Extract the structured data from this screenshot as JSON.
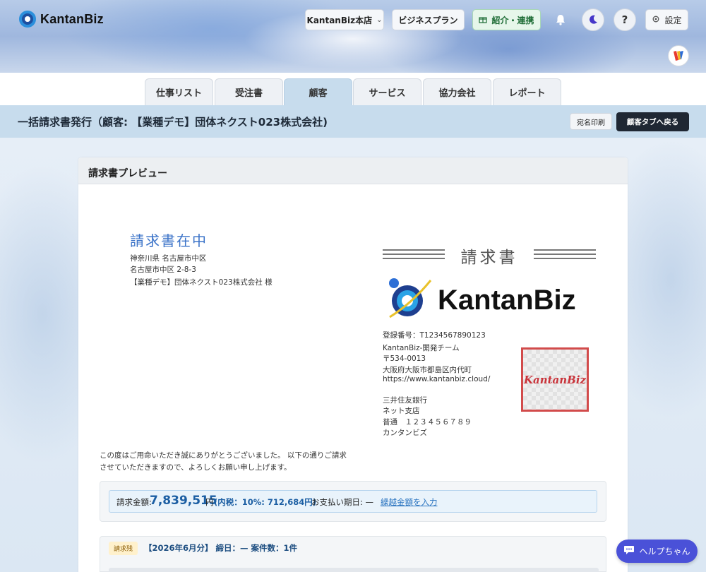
{
  "header": {
    "logo_text": "KantanBiz",
    "store_selector": "KantanBiz本店",
    "plan_button": "ビジネスプラン",
    "intro_button": "紹介・連携",
    "help_icon_label": "?",
    "settings_button": "設定"
  },
  "tabs": [
    {
      "label": "仕事リスト",
      "active": false
    },
    {
      "label": "受注書",
      "active": false
    },
    {
      "label": "顧客",
      "active": true
    },
    {
      "label": "サービス",
      "active": false
    },
    {
      "label": "協力会社",
      "active": false
    },
    {
      "label": "レポート",
      "active": false
    }
  ],
  "titlebar": {
    "title": "一括請求書発行（顧客: 【業種デモ】団体ネクスト023株式会社)",
    "print_button": "宛名印刷",
    "back_button": "顧客タブへ戻る"
  },
  "preview": {
    "section_title": "請求書プレビュー",
    "recipient": {
      "doc_title": "請求書在中",
      "address_line1": "神奈川県 名古屋市中区",
      "address_line2": "名古屋市中区 2-8-3",
      "name": "【業種デモ】団体ネクスト023株式会社 様"
    },
    "invoice_heading": "請求書",
    "issuer_logo_text": "KantanBiz",
    "issuer": {
      "registration": "登録番号：T1234567890123",
      "team": "KantanBiz-開発チーム",
      "postal": "〒534-0013",
      "address": "大阪府大阪市都島区内代町",
      "url": "https://www.kantanbiz.cloud/",
      "bank": "三井住友銀行",
      "branch": "ネット支店",
      "account": "普通　１２３４５６７８９",
      "account_name": "カンタンビズ"
    },
    "stamp_text": "KantanBiz",
    "thanks_line1": "この度はご用命いただき誠にありがとうございました。 以下の通りご請求",
    "thanks_line2": "させていただきますので、よろしくお願い申し上げます。",
    "amount": {
      "label": "請求金額:",
      "value": "7,839,515",
      "unit": "円",
      "tax": "(内税：10%: 712,684円)",
      "due": "お支払い期日: —",
      "carryover_link": "繰越金額を入力"
    },
    "period": {
      "badge": "請求残",
      "text": "【2026年6月分】 締日：— 案件数：1件"
    }
  },
  "help_chat": "ヘルプちゃん",
  "colors": {
    "accent_blue": "#3b73c8",
    "titlebar_bg": "#c7dced",
    "dark_button": "#1f2733",
    "help_chip": "#4a51d8",
    "stamp_red": "#d24b4b"
  }
}
